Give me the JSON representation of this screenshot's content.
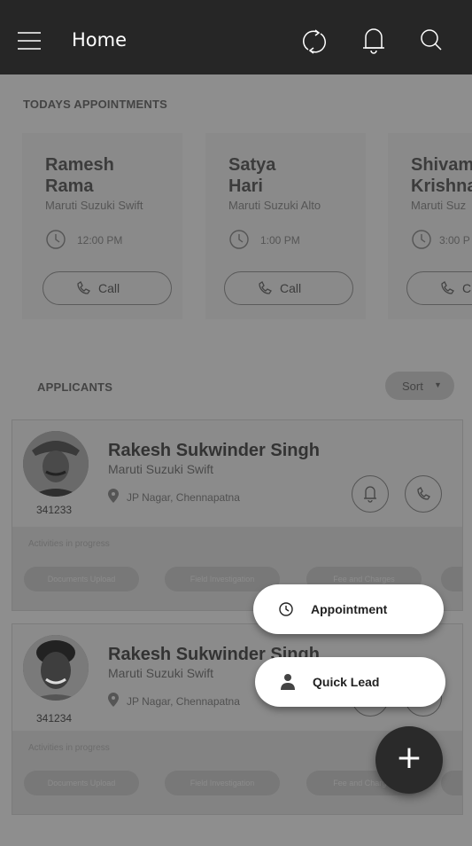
{
  "app_bar": {
    "title": "Home",
    "icons": [
      "menu-icon",
      "refresh-icon",
      "bell-icon",
      "search-icon"
    ]
  },
  "appointments": {
    "section_label": "TODAYS APPOINTMENTS",
    "items": [
      {
        "name_line1": "Ramesh",
        "name_line2": "Rama",
        "car": "Maruti Suzuki Swift",
        "time": "12:00 PM",
        "call_label": "Call"
      },
      {
        "name_line1": "Satya",
        "name_line2": "Hari",
        "car": "Maruti Suzuki Alto",
        "time": "1:00 PM",
        "call_label": "Call"
      },
      {
        "name_line1": "Shivam",
        "name_line2": "Krishna",
        "car": "Maruti Suz",
        "time": "3:00 P",
        "call_label": "C"
      }
    ]
  },
  "applicants": {
    "section_label": "APPLICANTS",
    "sort_label": "Sort",
    "items": [
      {
        "id": "341233",
        "name": "Rakesh Sukwinder Singh",
        "car": "Maruti Suzuki Swift",
        "location": "JP Nagar, Chennapatna",
        "activities_label": "Activities in progress",
        "activities": [
          "Documents Upload",
          "Field Investigation",
          "Fee and Charges"
        ]
      },
      {
        "id": "341234",
        "name": "Rakesh Sukwinder Singh",
        "car": "Maruti Suzuki Swift",
        "location": "JP Nagar, Chennapatna",
        "activities_label": "Activities in progress",
        "activities": [
          "Documents Upload",
          "Field Investigation",
          "Fee and Charges"
        ]
      }
    ]
  },
  "speed_dial": {
    "appointment_label": "Appointment",
    "quick_lead_label": "Quick Lead",
    "fab_symbol": "+"
  }
}
